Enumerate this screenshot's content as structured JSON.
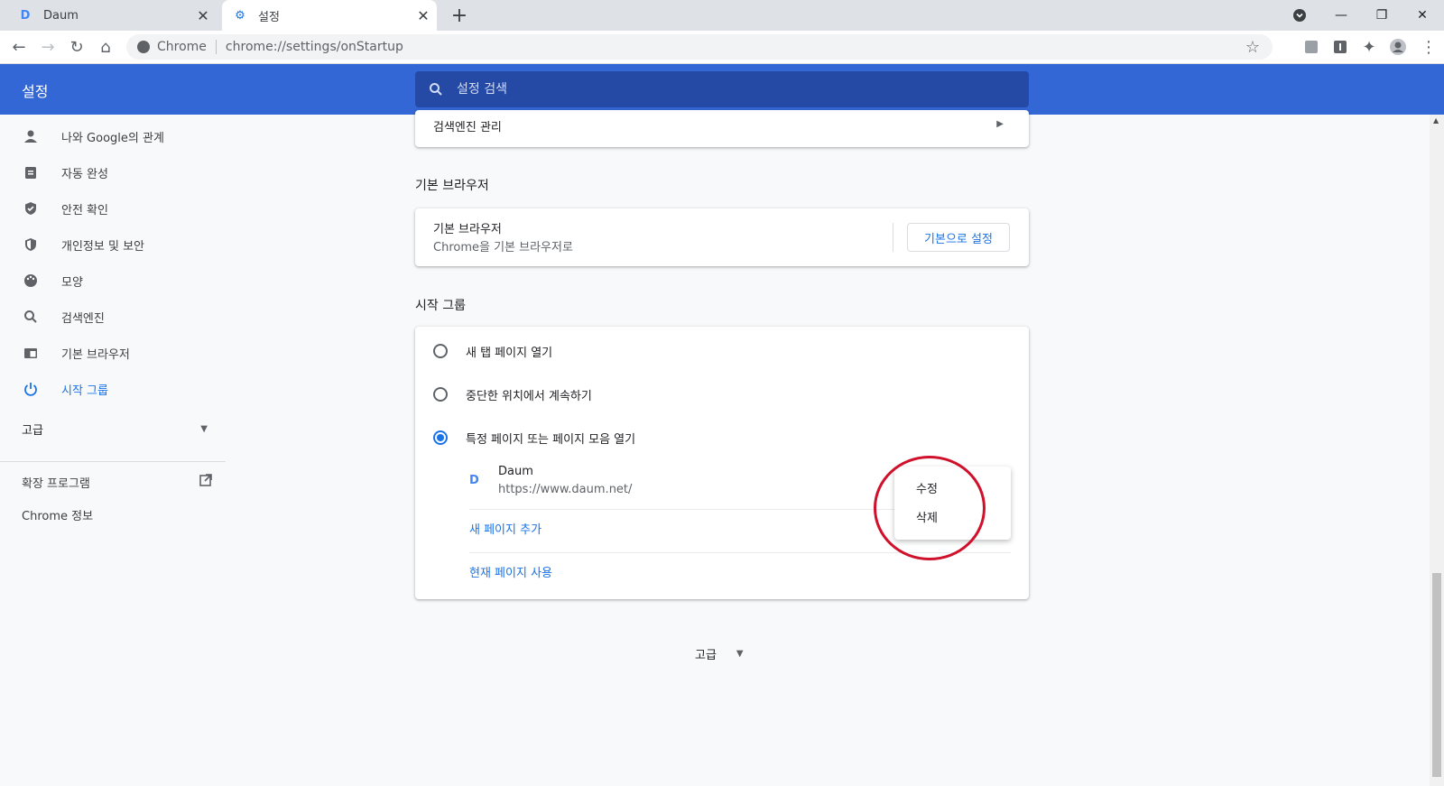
{
  "tabs": [
    {
      "title": "Daum",
      "icon": "daum-favicon"
    },
    {
      "title": "설정",
      "icon": "gear-icon"
    }
  ],
  "toolbar": {
    "site_label": "Chrome",
    "url": "chrome://settings/onStartup"
  },
  "header": {
    "title": "설정",
    "search_placeholder": "설정 검색"
  },
  "sidebar": {
    "items": [
      {
        "label": "나와 Google의 관계",
        "icon": "person-icon"
      },
      {
        "label": "자동 완성",
        "icon": "clipboard-icon"
      },
      {
        "label": "안전 확인",
        "icon": "shield-check-icon"
      },
      {
        "label": "개인정보 및 보안",
        "icon": "shield-icon"
      },
      {
        "label": "모양",
        "icon": "palette-icon"
      },
      {
        "label": "검색엔진",
        "icon": "search-icon"
      },
      {
        "label": "기본 브라우저",
        "icon": "browser-icon"
      },
      {
        "label": "시작 그룹",
        "icon": "power-icon",
        "active": true
      }
    ],
    "advanced": "고급",
    "extensions": "확장 프로그램",
    "about": "Chrome 정보"
  },
  "main": {
    "search_engine_manage": "검색엔진 관리",
    "default_browser": {
      "section_title": "기본 브라우저",
      "row_title": "기본 브라우저",
      "row_subtitle": "Chrome을 기본 브라우저로",
      "button": "기본으로 설정"
    },
    "startup": {
      "section_title": "시작 그룹",
      "options": [
        {
          "label": "새 탭 페이지 열기",
          "checked": false
        },
        {
          "label": "중단한 위치에서 계속하기",
          "checked": false
        },
        {
          "label": "특정 페이지 또는 페이지 모음 열기",
          "checked": true
        }
      ],
      "page": {
        "name": "Daum",
        "url": "https://www.daum.net/"
      },
      "add_page": "새 페이지 추가",
      "use_current": "현재 페이지 사용"
    },
    "advanced": "고급"
  },
  "context_menu": {
    "items": [
      "수정",
      "삭제"
    ]
  },
  "colors": {
    "header_blue": "#3367d6",
    "accent": "#1a73e8",
    "annotation_red": "#d0112b"
  }
}
